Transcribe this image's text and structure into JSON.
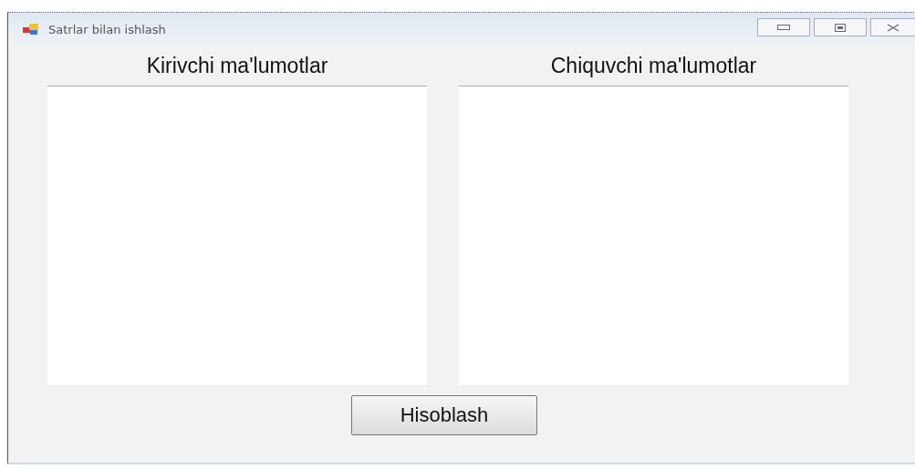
{
  "window": {
    "title": "Satrlar bilan ishlash"
  },
  "panels": [
    {
      "label": "Kirivchi ma'lumotlar"
    },
    {
      "label": "Chiquvchi ma'lumotlar"
    }
  ],
  "button": {
    "label": "Hisoblash"
  }
}
